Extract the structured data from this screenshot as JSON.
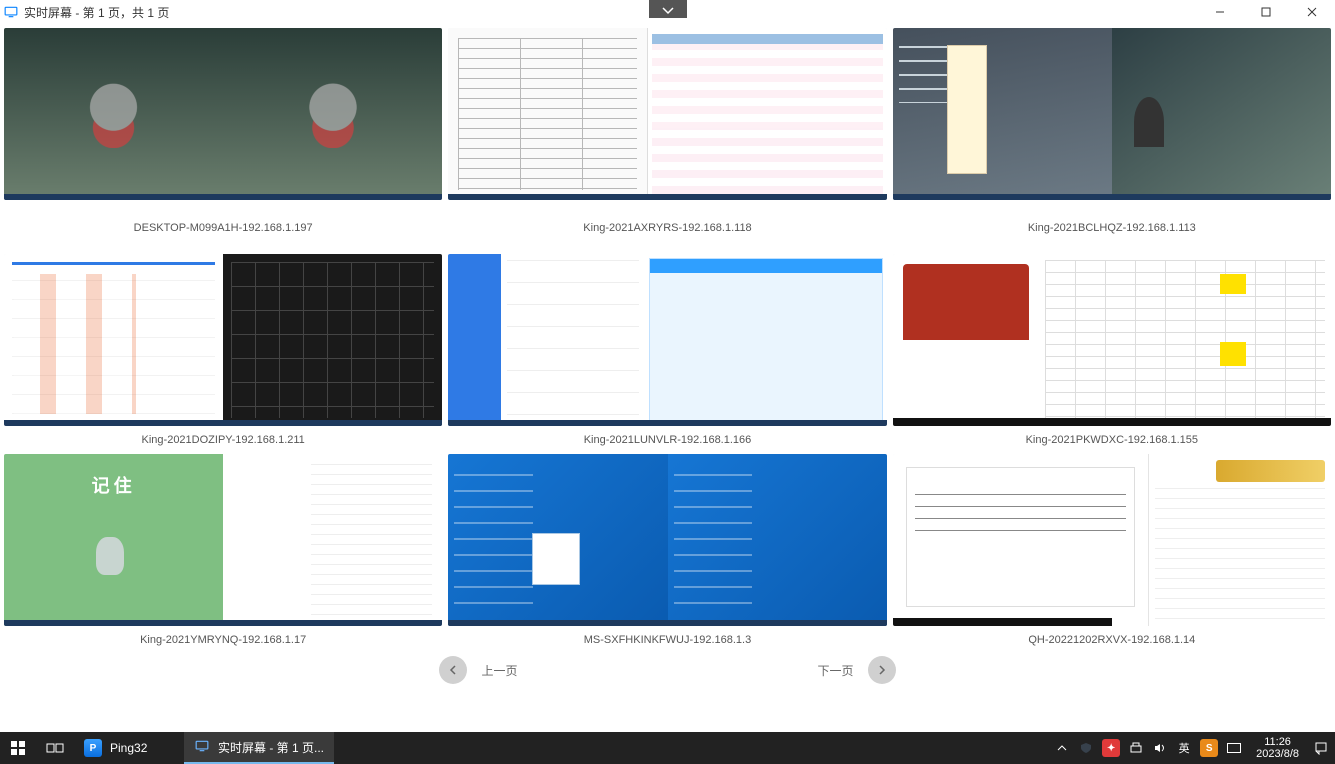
{
  "window": {
    "title": "实时屏幕 - 第 1 页，共 1 页"
  },
  "screens": [
    {
      "label": "DESKTOP-M099A1H-192.168.1.197"
    },
    {
      "label": "King-2021AXRYRS-192.168.1.118"
    },
    {
      "label": "King-2021BCLHQZ-192.168.1.113"
    },
    {
      "label": "King-2021DOZIPY-192.168.1.211"
    },
    {
      "label": "King-2021LUNVLR-192.168.1.166"
    },
    {
      "label": "King-2021PKWDXC-192.168.1.155"
    },
    {
      "label": "King-2021YMRYNQ-192.168.1.17"
    },
    {
      "label": "MS-SXFHKINKFWUJ-192.168.1.3"
    },
    {
      "label": "QH-20221202RXVX-192.168.1.14"
    }
  ],
  "pager": {
    "prev": "上一页",
    "next": "下一页"
  },
  "taskbar": {
    "app1": "Ping32",
    "app2": "实时屏幕 - 第 1 页...",
    "ime": "英",
    "sogou": "S",
    "time": "11:26",
    "date": "2023/8/8"
  }
}
